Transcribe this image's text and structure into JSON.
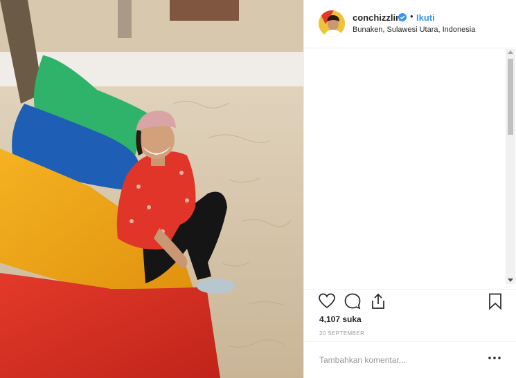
{
  "post": {
    "username": "conchizzlin",
    "follow_label": "Ikuti",
    "separator": "•",
    "location": "Bunaken, Sulawesi Utara, Indonesia",
    "likes": "4,107 suka",
    "date": "20 SEPTEMBER",
    "comment_placeholder": "Tambahkan komentar..."
  },
  "icons": {
    "verified": "verified-badge-icon",
    "like": "heart-icon",
    "comment": "comment-bubble-icon",
    "share": "share-upload-icon",
    "save": "bookmark-icon",
    "more": "ellipsis-icon"
  },
  "colors": {
    "link_blue": "#3897f0",
    "text": "#262626",
    "muted": "#999999",
    "border": "#efefef"
  }
}
